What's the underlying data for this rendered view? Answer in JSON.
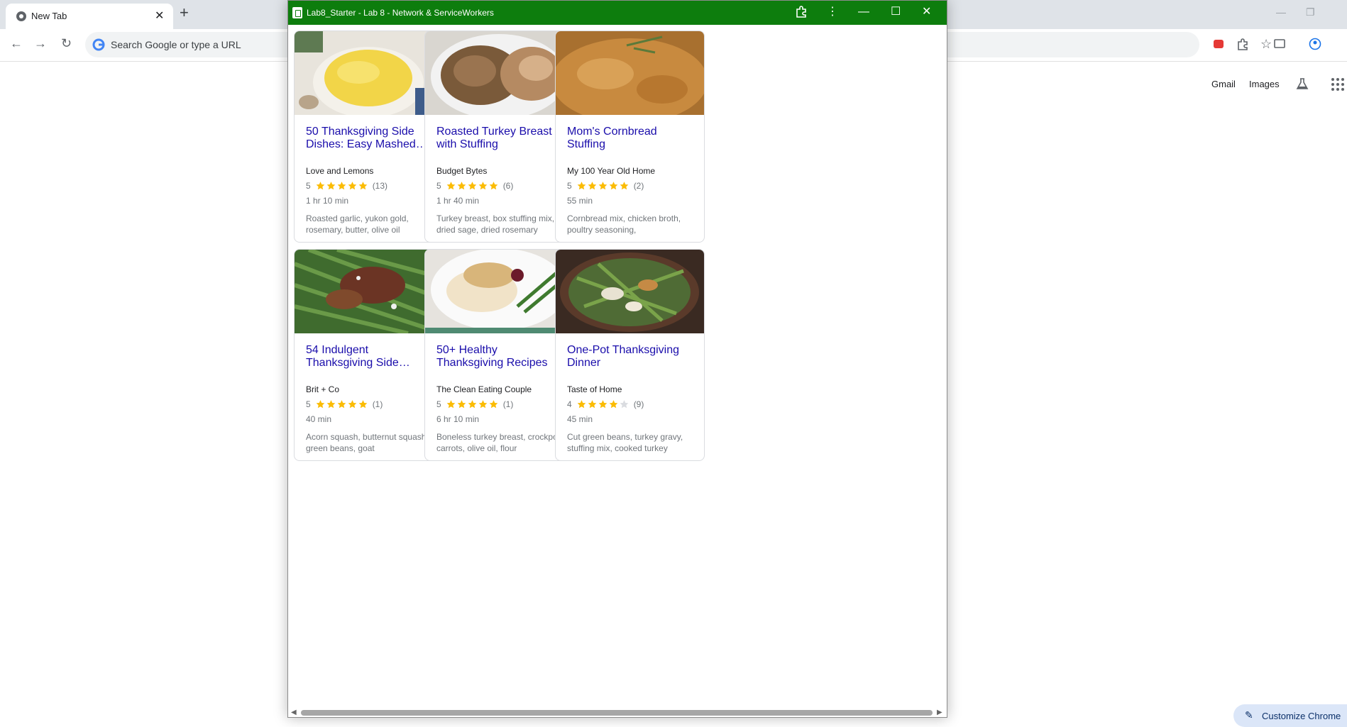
{
  "browser": {
    "tab_title": "New Tab",
    "omnibox_placeholder": "Search Google or type a URL",
    "ntp_links": {
      "gmail": "Gmail",
      "images": "Images"
    },
    "customize_label": "Customize Chrome"
  },
  "app": {
    "title": "Lab8_Starter - Lab 8 - Network & ServiceWorkers",
    "titlebar_color": "#0d7d0d"
  },
  "cards": [
    {
      "title": "50 Thanksgiving Side Dishes: Easy Mashed…",
      "org": "Love and Lemons",
      "rating": "5",
      "stars": 5,
      "reviews": "(13)",
      "time": "1 hr 10 min",
      "ingredients": "Roasted garlic, yukon gold, rosemary, butter, olive oil"
    },
    {
      "title": "Roasted Turkey Breast with Stuffing",
      "org": "Budget Bytes",
      "rating": "5",
      "stars": 5,
      "reviews": "(6)",
      "time": "1 hr 40 min",
      "ingredients": "Turkey breast, box stuffing mix, dried sage, dried rosemary"
    },
    {
      "title": "Mom's Cornbread Stuffing",
      "org": "My 100 Year Old Home",
      "rating": "5",
      "stars": 5,
      "reviews": "(2)",
      "time": "55 min",
      "ingredients": "Cornbread mix, chicken broth, poultry seasoning,"
    },
    {
      "title": "54 Indulgent Thanksgiving Side…",
      "org": "Brit + Co",
      "rating": "5",
      "stars": 5,
      "reviews": "(1)",
      "time": "40 min",
      "ingredients": "Acorn squash, butternut squash, green beans, goat"
    },
    {
      "title": "50+ Healthy Thanksgiving Recipes",
      "org": "The Clean Eating Couple",
      "rating": "5",
      "stars": 5,
      "reviews": "(1)",
      "time": "6 hr 10 min",
      "ingredients": "Boneless turkey breast, crockpot, carrots, olive oil, flour"
    },
    {
      "title": "One-Pot Thanksgiving Dinner",
      "org": "Taste of Home",
      "rating": "4",
      "stars": 4,
      "reviews": "(9)",
      "time": "45 min",
      "ingredients": "Cut green beans, turkey gravy, stuffing mix, cooked turkey"
    }
  ],
  "colors": {
    "title_link": "#1a0dab",
    "star_filled": "#fbbc04",
    "star_empty": "#dadce0"
  }
}
